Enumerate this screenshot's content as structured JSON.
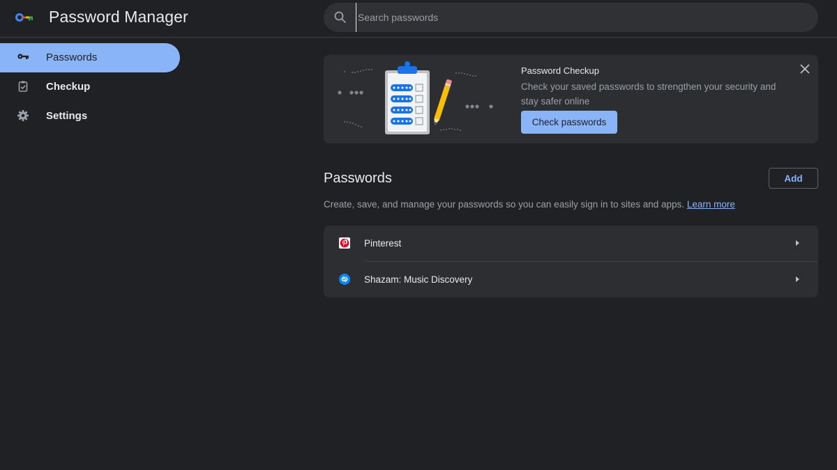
{
  "app": {
    "title": "Password Manager",
    "logo_icon": "key-logo-icon"
  },
  "search": {
    "placeholder": "Search passwords",
    "icon": "search-icon"
  },
  "sidebar": {
    "items": [
      {
        "label": "Passwords",
        "icon": "key-icon",
        "active": true
      },
      {
        "label": "Checkup",
        "icon": "clipboard-check-icon",
        "active": false
      },
      {
        "label": "Settings",
        "icon": "gear-icon",
        "active": false
      }
    ]
  },
  "checkup": {
    "title": "Password Checkup",
    "description": "Check your saved passwords to strengthen your security and stay safer online",
    "button_label": "Check passwords",
    "close_icon": "close-icon"
  },
  "passwords": {
    "title": "Passwords",
    "add_label": "Add",
    "description": "Create, save, and manage your passwords so you can easily sign in to sites and apps.",
    "learn_more": "Learn more",
    "items": [
      {
        "name": "Pinterest",
        "icon": "pinterest-icon"
      },
      {
        "name": "Shazam: Music Discovery",
        "icon": "shazam-icon"
      }
    ]
  },
  "colors": {
    "background": "#202124",
    "accent": "#8ab4f8",
    "card": "#2d2e31",
    "pinterest": "#e60023",
    "shazam": "#0088ff"
  }
}
